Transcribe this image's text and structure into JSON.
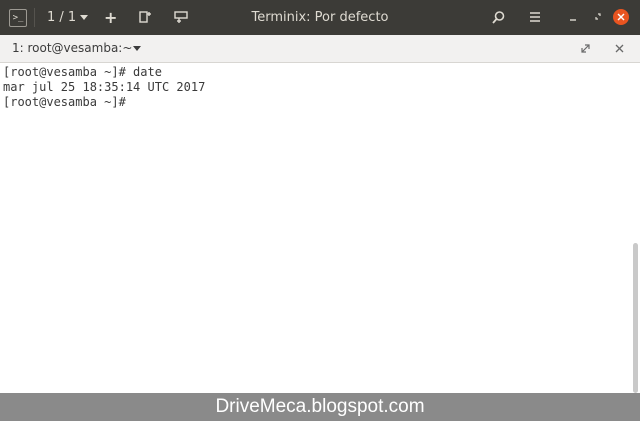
{
  "titlebar": {
    "terminal_icon_glyph": ">_",
    "session_count": "1 / 1",
    "window_title": "Terminix: Por defecto",
    "icons": [
      "terminal-icon",
      "session-dropdown-icon",
      "new-session-icon",
      "add-right-icon",
      "add-down-icon",
      "search-icon",
      "menu-icon",
      "minimize-icon",
      "restore-icon",
      "close-icon"
    ]
  },
  "tab": {
    "label": "1: root@vesamba:~"
  },
  "terminal": {
    "lines": [
      "[root@vesamba ~]# date",
      "mar jul 25 18:35:14 UTC 2017",
      "[root@vesamba ~]#"
    ]
  },
  "watermark": {
    "text": "DriveMeca.blogspot.com"
  },
  "colors": {
    "titlebar_bg": "#3c3b37",
    "tabbar_bg": "#f2f1f0",
    "terminal_bg": "#ffffff",
    "terminal_fg": "#3a3a3a",
    "watermark_bg": "#8a8a8a"
  }
}
